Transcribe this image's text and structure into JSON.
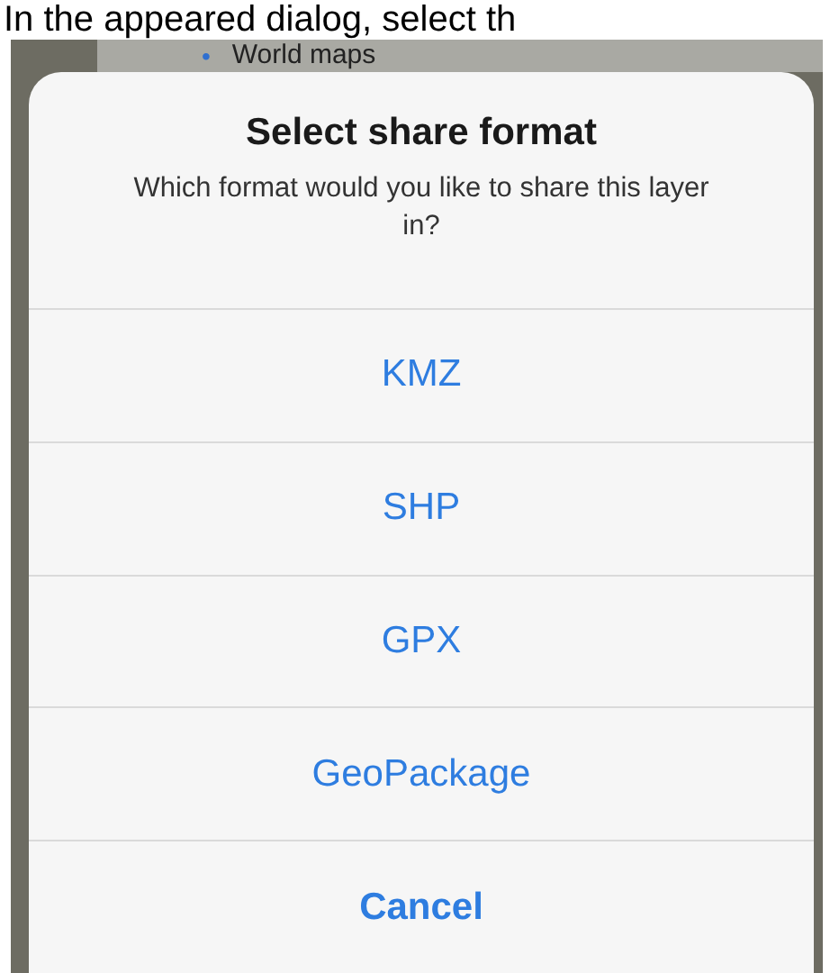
{
  "caption": "In the appeared dialog, select th",
  "background_item": {
    "bullet": "•",
    "label": "World maps"
  },
  "dialog": {
    "title": "Select share format",
    "message": "Which format would you like to share this layer in?",
    "actions": [
      {
        "label": "KMZ",
        "kind": "default"
      },
      {
        "label": "SHP",
        "kind": "default"
      },
      {
        "label": "GPX",
        "kind": "default"
      },
      {
        "label": "GeoPackage",
        "kind": "default"
      },
      {
        "label": "Cancel",
        "kind": "cancel"
      }
    ]
  }
}
